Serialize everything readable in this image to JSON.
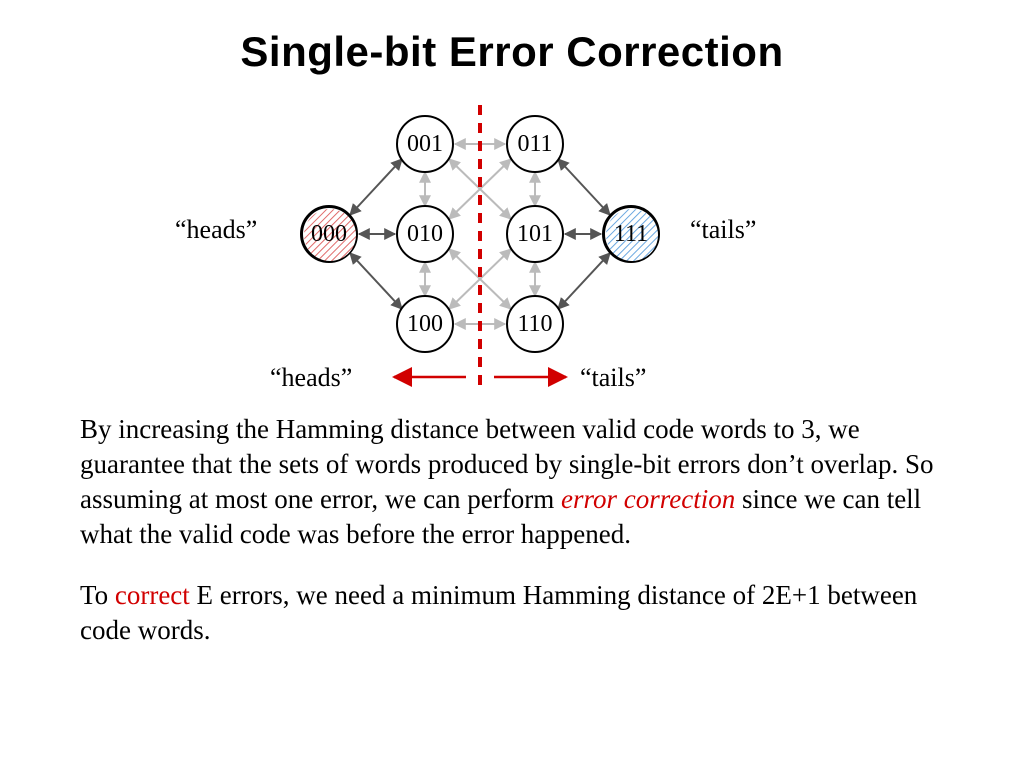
{
  "title": "Single-bit Error Correction",
  "diagram": {
    "nodes": {
      "n000": "000",
      "n001": "001",
      "n010": "010",
      "n100": "100",
      "n011": "011",
      "n101": "101",
      "n110": "110",
      "n111": "111"
    },
    "labels": {
      "heads_top": "“heads”",
      "tails_top": "“tails”",
      "heads_bottom": "“heads”",
      "tails_bottom": "“tails”"
    }
  },
  "para1": {
    "a": "By increasing the Hamming distance between valid code words to 3, we guarantee that the sets of words produced by single-bit errors don’t overlap.  So assuming at most one error, we can perform ",
    "em": "error correction",
    "b": " since we can tell what the valid code was before the error happened."
  },
  "para2": {
    "a": "To ",
    "red": "correct",
    "b": " E errors, we need a minimum Hamming distance of 2E+1 between code words."
  }
}
